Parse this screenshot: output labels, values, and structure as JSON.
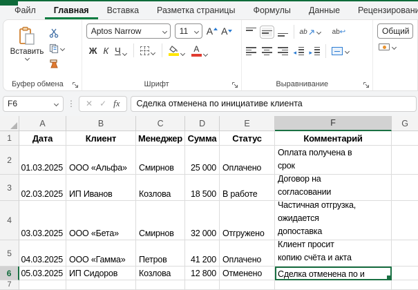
{
  "tabs": {
    "items": [
      {
        "label": "Файл",
        "active": false
      },
      {
        "label": "Главная",
        "active": true
      },
      {
        "label": "Вставка",
        "active": false
      },
      {
        "label": "Разметка страницы",
        "active": false
      },
      {
        "label": "Формулы",
        "active": false
      },
      {
        "label": "Данные",
        "active": false
      },
      {
        "label": "Рецензирование",
        "active": false
      }
    ]
  },
  "ribbon": {
    "paste_label": "Вставить",
    "clipboard_group_label": "Буфер обмена",
    "font_group_label": "Шрифт",
    "alignment_group_label": "Выравнивание",
    "font_name": "Aptos Narrow",
    "font_size": "11",
    "bold_label": "Ж",
    "italic_label": "К",
    "underline_label": "Ч",
    "grow_font_label": "A",
    "shrink_font_label": "A",
    "font_color_label": "A",
    "orientation_label": "ab",
    "wrap_label": "ab",
    "number_format_value": "Общий",
    "accent_color": "#107C41",
    "fill_color_swatch": "#ffe600",
    "font_color_swatch": "#e03c31"
  },
  "formula_bar": {
    "name_box": "F6",
    "cancel_icon": "✕",
    "enter_icon": "✓",
    "fx_label": "fx",
    "dots_icon": "⋮",
    "value": "Сделка отменена по инициативе клиента"
  },
  "sheet": {
    "columns": [
      "A",
      "B",
      "C",
      "D",
      "E",
      "F",
      "G"
    ],
    "selected_cell": "F6",
    "headers": [
      "Дата",
      "Клиент",
      "Менеджер",
      "Сумма",
      "Статус",
      "Комментарий"
    ],
    "header_row_number": "1",
    "rows": [
      {
        "n": "2",
        "date": "01.03.2025",
        "client": "ООО «Альфа»",
        "manager": "Смирнов",
        "amount": "25 000",
        "status": "Оплачено",
        "comment": "Оплата получена в\nсрок"
      },
      {
        "n": "3",
        "date": "02.03.2025",
        "client": "ИП Иванов",
        "manager": "Козлова",
        "amount": "18 500",
        "status": "В работе",
        "comment": "Договор на\nсогласовании"
      },
      {
        "n": "4",
        "date": "03.03.2025",
        "client": "ООО «Бета»",
        "manager": "Смирнов",
        "amount": "32 000",
        "status": "Отгружено",
        "comment": "Частичная отгрузка,\nожидается\nдопоставка"
      },
      {
        "n": "5",
        "date": "04.03.2025",
        "client": "ООО «Гамма»",
        "manager": "Петров",
        "amount": "41 200",
        "status": "Оплачено",
        "comment": "Клиент просит\nкопию счёта и акта"
      },
      {
        "n": "6",
        "date": "05.03.2025",
        "client": "ИП Сидоров",
        "manager": "Козлова",
        "amount": "12 800",
        "status": "Отменено",
        "comment": "Сделка отменена по и"
      }
    ],
    "row7_number": "7"
  }
}
